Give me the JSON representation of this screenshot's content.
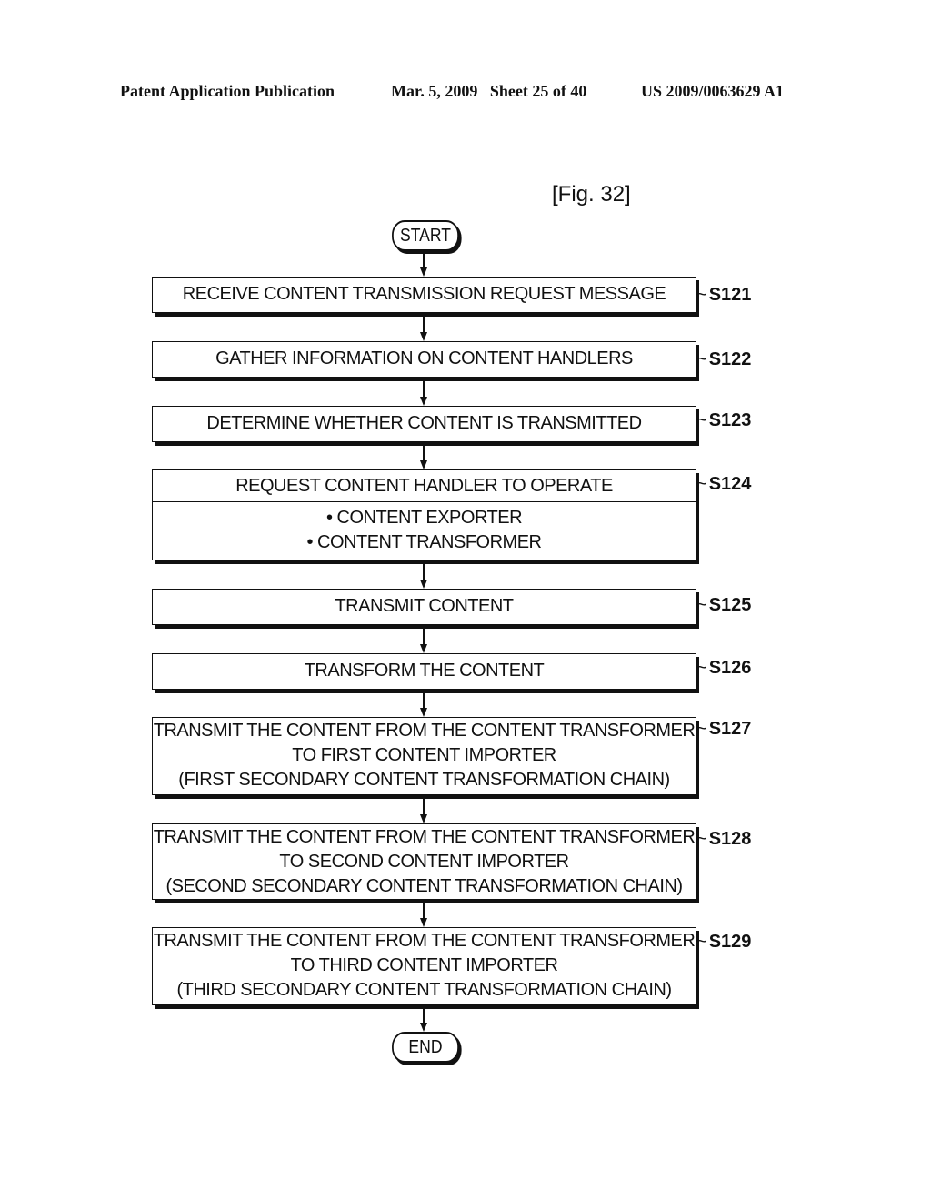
{
  "header": {
    "left": "Patent Application Publication",
    "middle": "Mar. 5, 2009   Sheet 25 of 40",
    "right": "US 2009/0063629 A1"
  },
  "figure_label": "[Fig. 32]",
  "start": "START",
  "end": "END",
  "steps": [
    {
      "id": "S121",
      "lines": [
        "RECEIVE CONTENT TRANSMISSION REQUEST MESSAGE"
      ]
    },
    {
      "id": "S122",
      "lines": [
        "GATHER INFORMATION ON CONTENT HANDLERS"
      ]
    },
    {
      "id": "S123",
      "lines": [
        "DETERMINE WHETHER CONTENT IS TRANSMITTED"
      ]
    },
    {
      "id": "S124",
      "lines": [
        "REQUEST CONTENT HANDLER TO OPERATE"
      ],
      "sub": [
        "• CONTENT EXPORTER",
        "• CONTENT TRANSFORMER"
      ]
    },
    {
      "id": "S125",
      "lines": [
        "TRANSMIT CONTENT"
      ]
    },
    {
      "id": "S126",
      "lines": [
        "TRANSFORM THE CONTENT"
      ]
    },
    {
      "id": "S127",
      "lines": [
        "TRANSMIT THE CONTENT FROM THE CONTENT TRANSFORMER",
        "TO FIRST CONTENT IMPORTER",
        "(FIRST SECONDARY CONTENT TRANSFORMATION CHAIN)"
      ]
    },
    {
      "id": "S128",
      "lines": [
        "TRANSMIT THE CONTENT FROM THE CONTENT TRANSFORMER",
        "TO SECOND CONTENT IMPORTER",
        "(SECOND SECONDARY CONTENT TRANSFORMATION CHAIN)"
      ]
    },
    {
      "id": "S129",
      "lines": [
        "TRANSMIT THE CONTENT FROM THE CONTENT TRANSFORMER",
        "TO THIRD CONTENT IMPORTER",
        "(THIRD SECONDARY CONTENT TRANSFORMATION CHAIN)"
      ]
    }
  ]
}
